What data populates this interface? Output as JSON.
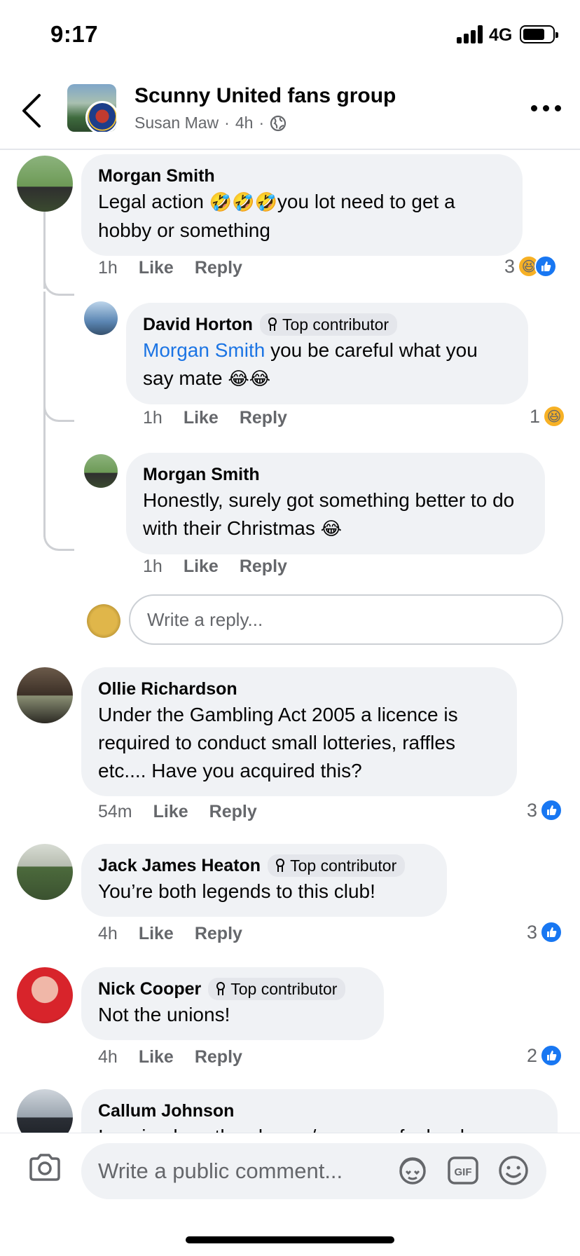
{
  "status_bar": {
    "time": "9:17",
    "network": "4G"
  },
  "header": {
    "group_name": "Scunny United fans group",
    "author": "Susan Maw",
    "separator": "·",
    "time_ago": "4h",
    "icons": [
      "back-icon",
      "globe-icon",
      "more-icon"
    ]
  },
  "comments": [
    {
      "name": "Morgan Smith",
      "text_a": "Legal action ",
      "emoji_a": "🤣🤣🤣",
      "text_b": "you lot need to get a hobby or something",
      "time": "1h",
      "like": "Like",
      "reply": "Reply",
      "reaction_count": "3",
      "reactions": [
        "haha",
        "like"
      ]
    },
    {
      "name": "David Horton",
      "badge": "Top contributor",
      "mention": "Morgan Smith",
      "text_a": " you be careful what you say mate ",
      "emoji_a": "😂😂",
      "time": "1h",
      "like": "Like",
      "reply": "Reply",
      "reaction_count": "1",
      "reactions": [
        "haha"
      ]
    },
    {
      "name": "Morgan Smith",
      "text_a": "Honestly, surely got something better to do with their Christmas ",
      "emoji_a": "😂",
      "time": "1h",
      "like": "Like",
      "reply": "Reply"
    },
    {
      "name": "Ollie Richardson",
      "text_a": "Under the Gambling Act 2005 a licence is required to conduct small lotteries, raffles etc.... Have you acquired this?",
      "time": "54m",
      "like": "Like",
      "reply": "Reply",
      "reaction_count": "3",
      "reactions": [
        "like"
      ]
    },
    {
      "name": "Jack James Heaton",
      "badge": "Top contributor",
      "text_a": "You’re both legends to this club!",
      "time": "4h",
      "like": "Like",
      "reply": "Reply",
      "reaction_count": "3",
      "reactions": [
        "like"
      ]
    },
    {
      "name": "Nick Cooper",
      "badge": "Top contributor",
      "text_a": "Not the unions!",
      "time": "4h",
      "like": "Like",
      "reply": "Reply",
      "reaction_count": "2",
      "reactions": [
        "like"
      ]
    },
    {
      "name": "Callum Johnson",
      "text_a": "Imagine how the players/manager feels when"
    }
  ],
  "reply_box": {
    "placeholder": "Write a reply..."
  },
  "composer": {
    "placeholder": "Write a public comment...",
    "icons": [
      "camera-icon",
      "avatar-sticker-icon",
      "gif-icon",
      "emoji-icon"
    ],
    "gif_label": "GIF"
  },
  "colors": {
    "link": "#1b74e4",
    "like_blue": "#1877f2",
    "bubble": "#f0f2f5",
    "meta_grey": "#65676b"
  }
}
